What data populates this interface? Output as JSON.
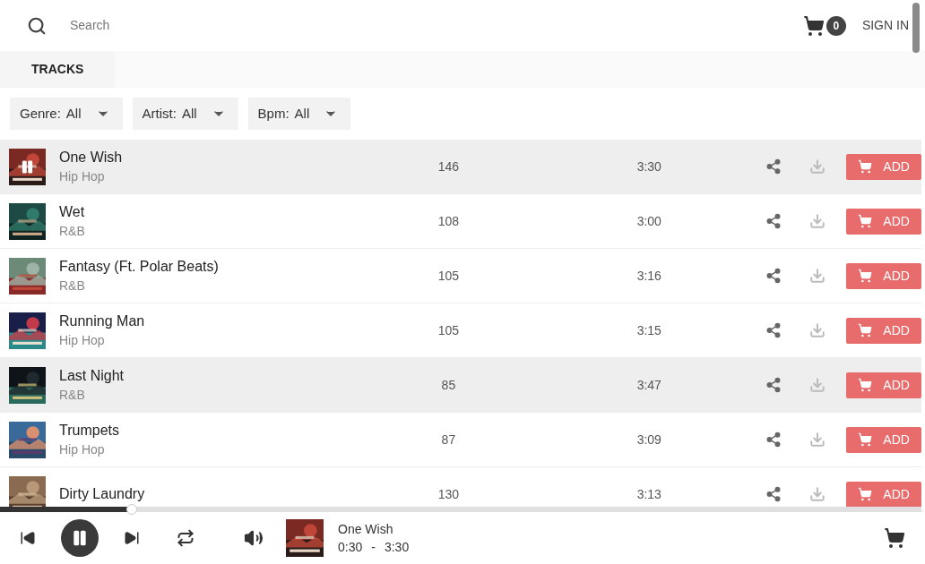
{
  "header": {
    "search": {
      "placeholder": "Search"
    },
    "cart_count": "0",
    "sign_in": "SIGN IN"
  },
  "tabs": [
    {
      "label": "TRACKS",
      "selected": true
    }
  ],
  "filters": [
    {
      "label": "Genre:",
      "value": "All"
    },
    {
      "label": "Artist:",
      "value": "All"
    },
    {
      "label": "Bpm:",
      "value": "All"
    }
  ],
  "tracks": [
    {
      "title": "One Wish",
      "genre": "Hip Hop",
      "bpm": "146",
      "duration": "3:30",
      "selected": true,
      "playing": true,
      "add": "ADD"
    },
    {
      "title": "Wet",
      "genre": "R&B",
      "bpm": "108",
      "duration": "3:00",
      "selected": false,
      "playing": false,
      "add": "ADD"
    },
    {
      "title": "Fantasy (Ft. Polar Beats)",
      "genre": "R&B",
      "bpm": "105",
      "duration": "3:16",
      "selected": false,
      "playing": false,
      "add": "ADD"
    },
    {
      "title": "Running Man",
      "genre": "Hip Hop",
      "bpm": "105",
      "duration": "3:15",
      "selected": false,
      "playing": false,
      "add": "ADD"
    },
    {
      "title": "Last Night",
      "genre": "R&B",
      "bpm": "85",
      "duration": "3:47",
      "selected": true,
      "playing": false,
      "add": "ADD"
    },
    {
      "title": "Trumpets",
      "genre": "Hip Hop",
      "bpm": "87",
      "duration": "3:09",
      "selected": false,
      "playing": false,
      "add": "ADD"
    },
    {
      "title": "Dirty Laundry",
      "bpm": "130",
      "duration": "3:13",
      "selected": false,
      "playing": false,
      "add": "ADD"
    }
  ],
  "player": {
    "level": 0.143,
    "playing": true,
    "title": "One Wish",
    "elapsed": "0:30",
    "separator": "-",
    "total": "3:30"
  }
}
